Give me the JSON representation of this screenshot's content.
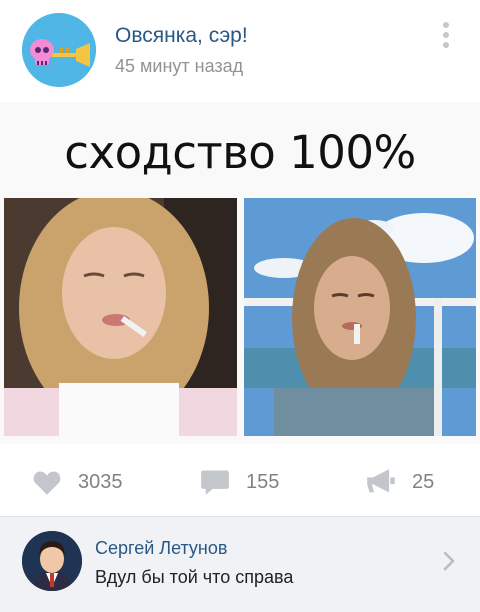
{
  "post": {
    "community_name": "Овсянка, сэр!",
    "timestamp": "45 минут назад",
    "menu_icon": "more-vertical-icon",
    "avatar_icon": "skull-trumpet-icon",
    "caption": "сходство 100%"
  },
  "actions": {
    "likes": "3035",
    "comments": "155",
    "shares": "25"
  },
  "comment": {
    "author": "Сергей Летунов",
    "text": "Вдул бы той что справа"
  },
  "colors": {
    "link": "#2a5885",
    "avatar_bg": "#4fb6e6",
    "icon_gray": "#c3c7cc",
    "comment_bg": "#f0f2f5"
  }
}
